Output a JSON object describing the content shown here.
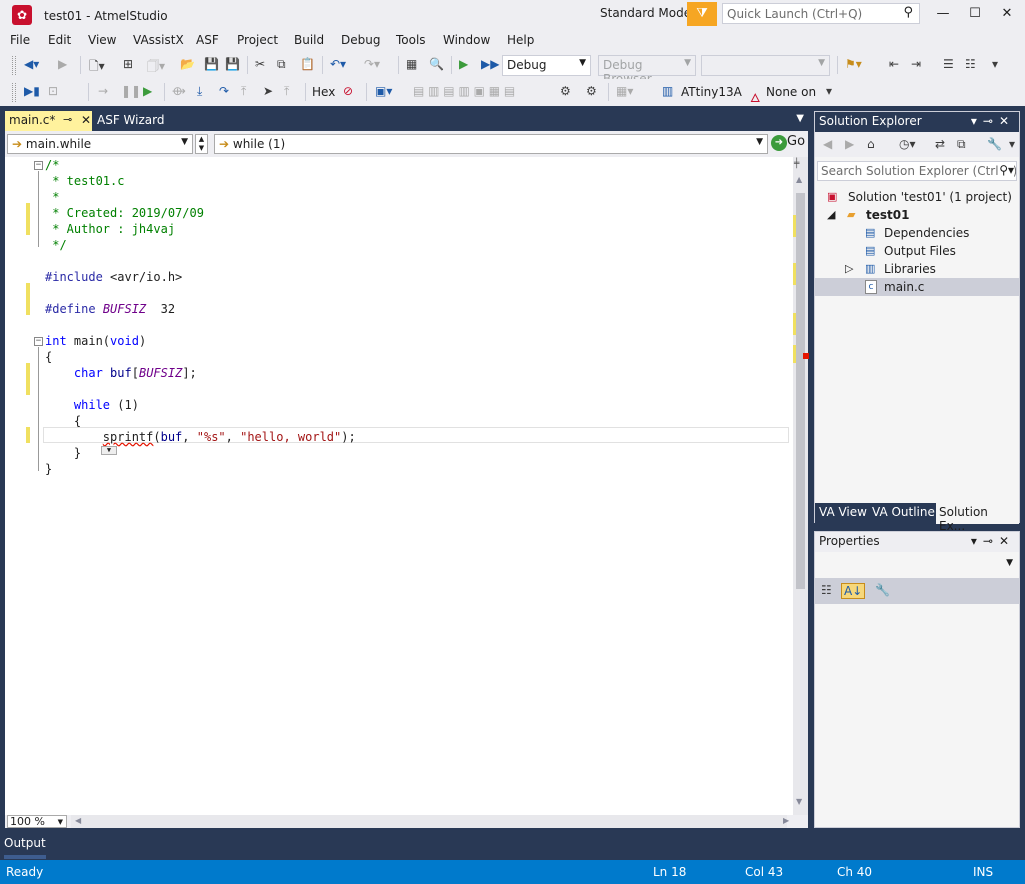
{
  "window": {
    "title": "test01 - AtmelStudio",
    "mode": "Standard Mode",
    "quick_launch_placeholder": "Quick Launch (Ctrl+Q)"
  },
  "menu": [
    "File",
    "Edit",
    "View",
    "VAssistX",
    "ASF",
    "Project",
    "Build",
    "Debug",
    "Tools",
    "Window",
    "Help"
  ],
  "toolbar": {
    "config": "Debug",
    "debug_browser": "Debug Browser",
    "hex": "Hex",
    "device": "ATtiny13A",
    "tool": "None on"
  },
  "tabs": {
    "active": "main.c*",
    "inactive": "ASF Wizard"
  },
  "navbar": {
    "scope": "main.while",
    "symbol": "while (1)",
    "go": "Go"
  },
  "code": {
    "lines": [
      [
        "/*"
      ],
      [
        " * test01.c"
      ],
      [
        " *"
      ],
      [
        " * Created: 2019/07/09"
      ],
      [
        " * Author : jh4vaj"
      ],
      [
        " */"
      ],
      [
        ""
      ],
      [
        "#include <avr/io.h>"
      ],
      [
        ""
      ],
      [
        "#define BUFSIZ  32"
      ],
      [
        ""
      ],
      [
        "int main(void)"
      ],
      [
        "{"
      ],
      [
        "    char buf[BUFSIZ];"
      ],
      [
        ""
      ],
      [
        "    while (1)"
      ],
      [
        "    {"
      ],
      [
        "        sprintf(buf, \"%s\", \"hello, world\");"
      ],
      [
        "    }"
      ],
      [
        "}"
      ]
    ],
    "tokens": {
      "c1": "/*",
      "c2": " * test01.c",
      "c3": " *",
      "c4": " * Created: 2019/07/09",
      "c5": " * Author : jh4vaj",
      "c6": " */",
      "inc_kw": "#include",
      "inc_path": " <avr/io.h>",
      "def_kw": "#define",
      "def_name": "BUFSIZ",
      "def_val": "  32",
      "int_kw": "int",
      "main_sig": " main(",
      "void_kw": "void",
      "main_end": ")",
      "open1": "{",
      "char_kw": "char",
      "buf_var": "buf",
      "arr_open": "[",
      "bufsiz_ref": "BUFSIZ",
      "arr_close": "];",
      "while_kw": "while",
      "while_cond": " (1)",
      "open2": "{",
      "sprintf_fn": "sprintf",
      "sp_open": "(",
      "sp_buf": "buf",
      "sp_comma": ", ",
      "sp_fmt": "\"%s\"",
      "sp_comma2": ", ",
      "sp_str": "\"hello, world\"",
      "sp_end": ");",
      "close2": "}",
      "close1": "}"
    }
  },
  "zoom": "100 %",
  "solution_explorer": {
    "title": "Solution Explorer",
    "search_placeholder": "Search Solution Explorer (Ctrl+;)",
    "items": [
      {
        "label": "Solution 'test01' (1 project)"
      },
      {
        "label": "test01"
      },
      {
        "label": "Dependencies"
      },
      {
        "label": "Output Files"
      },
      {
        "label": "Libraries"
      },
      {
        "label": "main.c"
      }
    ],
    "bottom_tabs": [
      "VA View",
      "VA Outline",
      "Solution Ex..."
    ]
  },
  "properties": {
    "title": "Properties"
  },
  "output": {
    "tab": "Output"
  },
  "status": {
    "ready": "Ready",
    "ln": "Ln 18",
    "col": "Col 43",
    "ch": "Ch 40",
    "ins": "INS"
  },
  "colors": {
    "accent_blue": "#007acc",
    "dark_frame": "#293955",
    "active_tab": "#fff29d",
    "filter_orange": "#f6a623"
  }
}
